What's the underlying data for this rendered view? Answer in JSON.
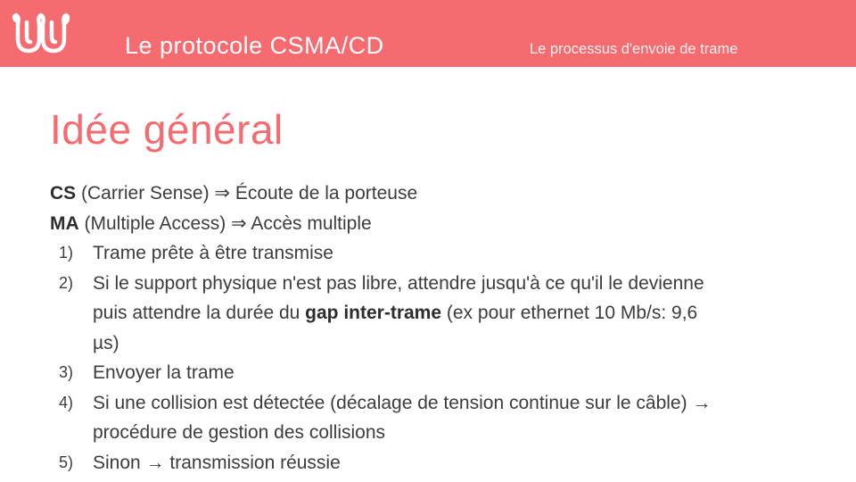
{
  "header": {
    "logo_icon": "wavy-u-logo",
    "title": "Le protocole CSMA/CD",
    "subtitle": "Le processus d'envoie de trame",
    "accent_color": "#f56b6f"
  },
  "slide": {
    "title": "Idée général",
    "cs": {
      "abbr": "CS",
      "rest": " (Carrier Sense) ⇒ Écoute de la porteuse"
    },
    "ma": {
      "abbr": "MA",
      "rest": " (Multiple Access) ⇒ Accès multiple"
    },
    "steps": [
      {
        "num": "1)",
        "text": "Trame prête à être transmise"
      },
      {
        "num": "2)",
        "line1": "Si le support physique n'est pas libre, attendre jusqu'à ce qu'il le devienne",
        "line2_pre": "puis attendre la durée du ",
        "line2_bold": "gap inter-trame",
        "line2_post": " (ex pour ethernet 10 Mb/s: 9,6",
        "line3": "µs)"
      },
      {
        "num": "3)",
        "text": "Envoyer la trame"
      },
      {
        "num": "4)",
        "line1": "Si une collision est détectée (décalage de tension continue sur le câble) →",
        "line2": "procédure de gestion des collisions"
      },
      {
        "num": "5)",
        "text": "Sinon → transmission réussie"
      }
    ]
  }
}
